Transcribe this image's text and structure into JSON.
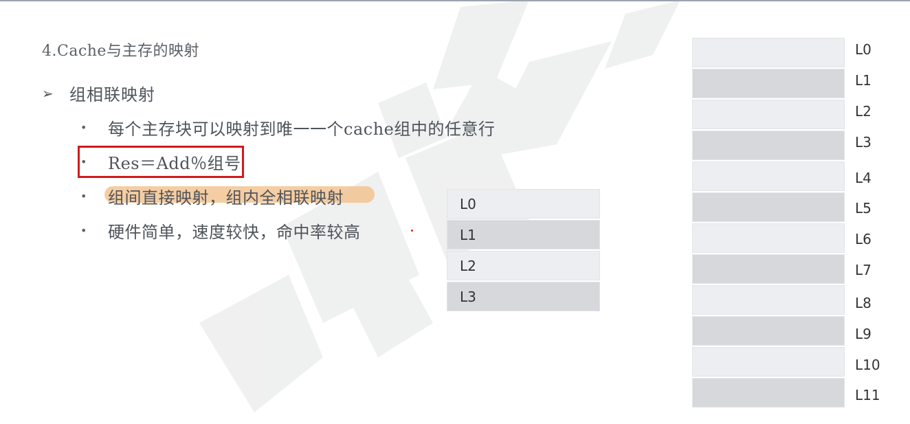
{
  "slide": {
    "section_title": "4.Cache与主存的映射",
    "heading": {
      "bullet_glyph": "➢",
      "text": "组相联映射"
    },
    "bullets": [
      {
        "glyph": "•",
        "text": "每个主存块可以映射到唯一一个cache组中的任意行"
      },
      {
        "glyph": "•",
        "text": "Res＝Add％组号"
      },
      {
        "glyph": "•",
        "text": "组间直接映射，组内全相联映射"
      },
      {
        "glyph": "•",
        "text": "硬件简单，速度较快，命中率较高"
      }
    ],
    "highlight_color": "#f3c08b",
    "box_color": "#d11a1a"
  },
  "cache_lines": [
    "L0",
    "L1",
    "L2",
    "L3"
  ],
  "memory_lines": [
    "L0",
    "L1",
    "L2",
    "L3",
    "L4",
    "L5",
    "L6",
    "L7",
    "L8",
    "L9",
    "L10",
    "L11"
  ]
}
